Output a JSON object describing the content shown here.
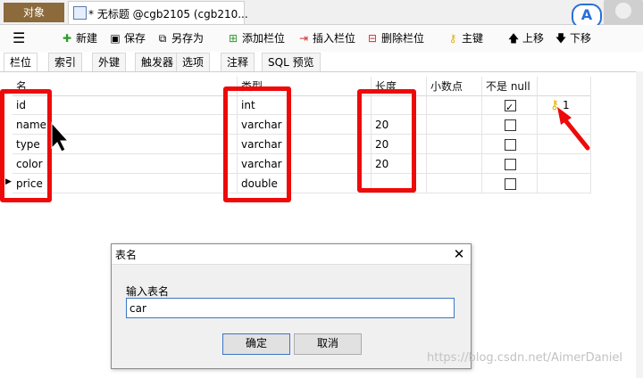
{
  "tabs": {
    "objects_label": "对象",
    "table_tab_label": "* 无标题 @cgb2105 (cgb210..."
  },
  "account": {
    "initial": "A"
  },
  "toolbar": {
    "new": "新建",
    "save": "保存",
    "save_as": "另存为",
    "add_column": "添加栏位",
    "insert_column": "插入栏位",
    "delete_column": "删除栏位",
    "primary_key": "主键",
    "move_up": "上移",
    "move_down": "下移"
  },
  "subtabs": [
    "栏位",
    "索引",
    "外键",
    "触发器",
    "选项",
    "注释",
    "SQL 预览"
  ],
  "grid": {
    "headers": {
      "name": "名",
      "type": "类型",
      "length": "长度",
      "decimals": "小数点",
      "not_null": "不是 null"
    },
    "rows": [
      {
        "name": "id",
        "type": "int",
        "length": "",
        "not_null": true,
        "key": "1"
      },
      {
        "name": "name",
        "type": "varchar",
        "length": "20",
        "not_null": false,
        "key": ""
      },
      {
        "name": "type",
        "type": "varchar",
        "length": "20",
        "not_null": false,
        "key": ""
      },
      {
        "name": "color",
        "type": "varchar",
        "length": "20",
        "not_null": false,
        "key": ""
      },
      {
        "name": "price",
        "type": "double",
        "length": "",
        "not_null": false,
        "key": ""
      }
    ]
  },
  "dialog": {
    "title": "表名",
    "label": "输入表名",
    "value": "car",
    "ok": "确定",
    "cancel": "取消"
  },
  "watermark": "https://blog.csdn.net/AimerDaniel",
  "colors": {
    "annotation_red": "#ee0a0a",
    "objects_tab": "#8c6a3c",
    "key_gold": "#e0b000"
  }
}
